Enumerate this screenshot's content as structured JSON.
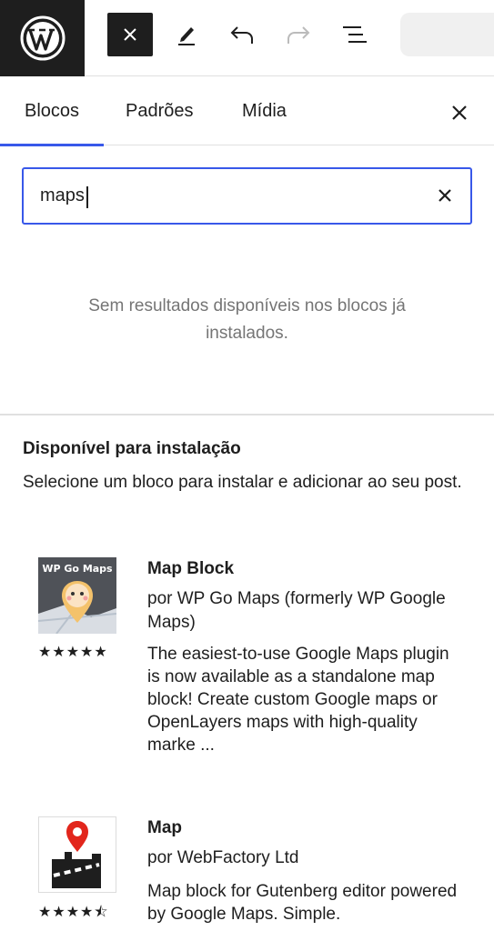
{
  "toolbar": {
    "logo_icon": "wordpress-logo",
    "buttons": [
      "close-icon",
      "pen-icon",
      "undo-icon",
      "redo-icon",
      "list-view-icon"
    ]
  },
  "tabs": [
    {
      "label": "Blocos"
    },
    {
      "label": "Padrões"
    },
    {
      "label": "Mídia"
    }
  ],
  "search": {
    "value": "maps"
  },
  "no_results": "Sem resultados disponíveis nos blocos já instalados.",
  "available": {
    "title": "Disponível para instalação",
    "description": "Selecione um bloco para instalar e adicionar ao seu post."
  },
  "results": [
    {
      "thumbnail_text": "WP Go Maps",
      "rating_stars": 5,
      "stars_text": "★★★★★",
      "title": "Map Block",
      "author": "por WP Go Maps (formerly WP Google Maps)",
      "description": "The easiest-to-use Google Maps plugin is now available as a standalone map block! Create custom Google maps or OpenLayers maps with high-quality marke ..."
    },
    {
      "rating_stars": 4.5,
      "stars_text": "★★★★⯪",
      "title": "Map",
      "author": "por WebFactory Ltd",
      "description": "Map block for Gutenberg editor powered by Google Maps. Simple."
    }
  ],
  "colors": {
    "accent": "#3858e9",
    "dark": "#1e1e1e",
    "muted": "#757575",
    "border": "#e0e0e0"
  }
}
